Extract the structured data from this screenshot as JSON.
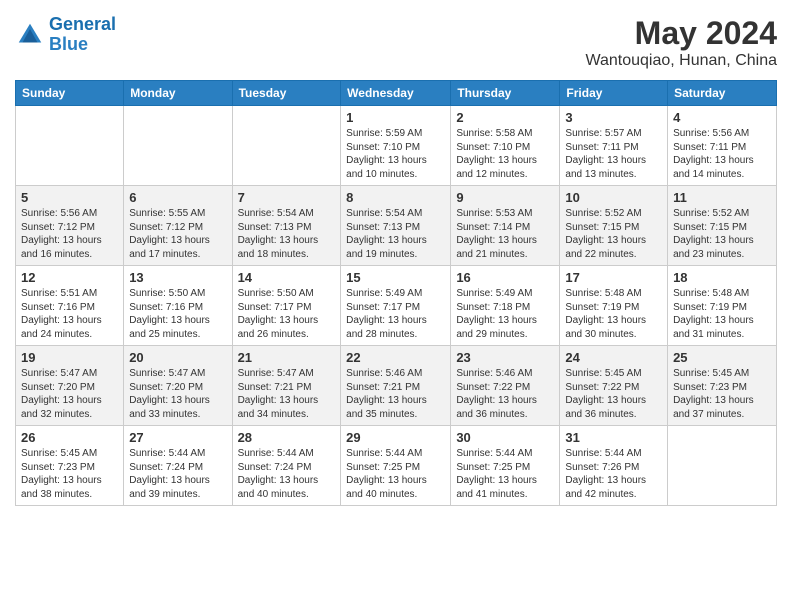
{
  "header": {
    "logo_general": "General",
    "logo_blue": "Blue",
    "month": "May 2024",
    "location": "Wantouqiao, Hunan, China"
  },
  "days_of_week": [
    "Sunday",
    "Monday",
    "Tuesday",
    "Wednesday",
    "Thursday",
    "Friday",
    "Saturday"
  ],
  "weeks": [
    [
      {
        "day": "",
        "info": ""
      },
      {
        "day": "",
        "info": ""
      },
      {
        "day": "",
        "info": ""
      },
      {
        "day": "1",
        "info": "Sunrise: 5:59 AM\nSunset: 7:10 PM\nDaylight: 13 hours\nand 10 minutes."
      },
      {
        "day": "2",
        "info": "Sunrise: 5:58 AM\nSunset: 7:10 PM\nDaylight: 13 hours\nand 12 minutes."
      },
      {
        "day": "3",
        "info": "Sunrise: 5:57 AM\nSunset: 7:11 PM\nDaylight: 13 hours\nand 13 minutes."
      },
      {
        "day": "4",
        "info": "Sunrise: 5:56 AM\nSunset: 7:11 PM\nDaylight: 13 hours\nand 14 minutes."
      }
    ],
    [
      {
        "day": "5",
        "info": "Sunrise: 5:56 AM\nSunset: 7:12 PM\nDaylight: 13 hours\nand 16 minutes."
      },
      {
        "day": "6",
        "info": "Sunrise: 5:55 AM\nSunset: 7:12 PM\nDaylight: 13 hours\nand 17 minutes."
      },
      {
        "day": "7",
        "info": "Sunrise: 5:54 AM\nSunset: 7:13 PM\nDaylight: 13 hours\nand 18 minutes."
      },
      {
        "day": "8",
        "info": "Sunrise: 5:54 AM\nSunset: 7:13 PM\nDaylight: 13 hours\nand 19 minutes."
      },
      {
        "day": "9",
        "info": "Sunrise: 5:53 AM\nSunset: 7:14 PM\nDaylight: 13 hours\nand 21 minutes."
      },
      {
        "day": "10",
        "info": "Sunrise: 5:52 AM\nSunset: 7:15 PM\nDaylight: 13 hours\nand 22 minutes."
      },
      {
        "day": "11",
        "info": "Sunrise: 5:52 AM\nSunset: 7:15 PM\nDaylight: 13 hours\nand 23 minutes."
      }
    ],
    [
      {
        "day": "12",
        "info": "Sunrise: 5:51 AM\nSunset: 7:16 PM\nDaylight: 13 hours\nand 24 minutes."
      },
      {
        "day": "13",
        "info": "Sunrise: 5:50 AM\nSunset: 7:16 PM\nDaylight: 13 hours\nand 25 minutes."
      },
      {
        "day": "14",
        "info": "Sunrise: 5:50 AM\nSunset: 7:17 PM\nDaylight: 13 hours\nand 26 minutes."
      },
      {
        "day": "15",
        "info": "Sunrise: 5:49 AM\nSunset: 7:17 PM\nDaylight: 13 hours\nand 28 minutes."
      },
      {
        "day": "16",
        "info": "Sunrise: 5:49 AM\nSunset: 7:18 PM\nDaylight: 13 hours\nand 29 minutes."
      },
      {
        "day": "17",
        "info": "Sunrise: 5:48 AM\nSunset: 7:19 PM\nDaylight: 13 hours\nand 30 minutes."
      },
      {
        "day": "18",
        "info": "Sunrise: 5:48 AM\nSunset: 7:19 PM\nDaylight: 13 hours\nand 31 minutes."
      }
    ],
    [
      {
        "day": "19",
        "info": "Sunrise: 5:47 AM\nSunset: 7:20 PM\nDaylight: 13 hours\nand 32 minutes."
      },
      {
        "day": "20",
        "info": "Sunrise: 5:47 AM\nSunset: 7:20 PM\nDaylight: 13 hours\nand 33 minutes."
      },
      {
        "day": "21",
        "info": "Sunrise: 5:47 AM\nSunset: 7:21 PM\nDaylight: 13 hours\nand 34 minutes."
      },
      {
        "day": "22",
        "info": "Sunrise: 5:46 AM\nSunset: 7:21 PM\nDaylight: 13 hours\nand 35 minutes."
      },
      {
        "day": "23",
        "info": "Sunrise: 5:46 AM\nSunset: 7:22 PM\nDaylight: 13 hours\nand 36 minutes."
      },
      {
        "day": "24",
        "info": "Sunrise: 5:45 AM\nSunset: 7:22 PM\nDaylight: 13 hours\nand 36 minutes."
      },
      {
        "day": "25",
        "info": "Sunrise: 5:45 AM\nSunset: 7:23 PM\nDaylight: 13 hours\nand 37 minutes."
      }
    ],
    [
      {
        "day": "26",
        "info": "Sunrise: 5:45 AM\nSunset: 7:23 PM\nDaylight: 13 hours\nand 38 minutes."
      },
      {
        "day": "27",
        "info": "Sunrise: 5:44 AM\nSunset: 7:24 PM\nDaylight: 13 hours\nand 39 minutes."
      },
      {
        "day": "28",
        "info": "Sunrise: 5:44 AM\nSunset: 7:24 PM\nDaylight: 13 hours\nand 40 minutes."
      },
      {
        "day": "29",
        "info": "Sunrise: 5:44 AM\nSunset: 7:25 PM\nDaylight: 13 hours\nand 40 minutes."
      },
      {
        "day": "30",
        "info": "Sunrise: 5:44 AM\nSunset: 7:25 PM\nDaylight: 13 hours\nand 41 minutes."
      },
      {
        "day": "31",
        "info": "Sunrise: 5:44 AM\nSunset: 7:26 PM\nDaylight: 13 hours\nand 42 minutes."
      },
      {
        "day": "",
        "info": ""
      }
    ]
  ]
}
